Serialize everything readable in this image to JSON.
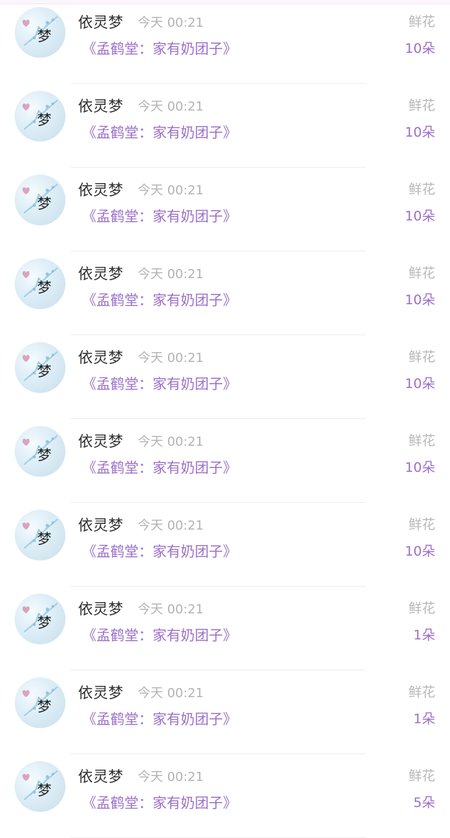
{
  "colors": {
    "accent": "#9b70c8",
    "muted": "#b3b3b3",
    "text": "#2f2f2f"
  },
  "rows": [
    {
      "name": "依灵梦",
      "time": "今天 00:21",
      "book": "《孟鹤堂：家有奶团子》",
      "gift": "鲜花",
      "qty": "10朵"
    },
    {
      "name": "依灵梦",
      "time": "今天 00:21",
      "book": "《孟鹤堂：家有奶团子》",
      "gift": "鲜花",
      "qty": "10朵"
    },
    {
      "name": "依灵梦",
      "time": "今天 00:21",
      "book": "《孟鹤堂：家有奶团子》",
      "gift": "鲜花",
      "qty": "10朵"
    },
    {
      "name": "依灵梦",
      "time": "今天 00:21",
      "book": "《孟鹤堂：家有奶团子》",
      "gift": "鲜花",
      "qty": "10朵"
    },
    {
      "name": "依灵梦",
      "time": "今天 00:21",
      "book": "《孟鹤堂：家有奶团子》",
      "gift": "鲜花",
      "qty": "10朵"
    },
    {
      "name": "依灵梦",
      "time": "今天 00:21",
      "book": "《孟鹤堂：家有奶团子》",
      "gift": "鲜花",
      "qty": "10朵"
    },
    {
      "name": "依灵梦",
      "time": "今天 00:21",
      "book": "《孟鹤堂：家有奶团子》",
      "gift": "鲜花",
      "qty": "10朵"
    },
    {
      "name": "依灵梦",
      "time": "今天 00:21",
      "book": "《孟鹤堂：家有奶团子》",
      "gift": "鲜花",
      "qty": "1朵"
    },
    {
      "name": "依灵梦",
      "time": "今天 00:21",
      "book": "《孟鹤堂：家有奶团子》",
      "gift": "鲜花",
      "qty": "1朵"
    },
    {
      "name": "依灵梦",
      "time": "今天 00:21",
      "book": "《孟鹤堂：家有奶团子》",
      "gift": "鲜花",
      "qty": "5朵"
    }
  ]
}
